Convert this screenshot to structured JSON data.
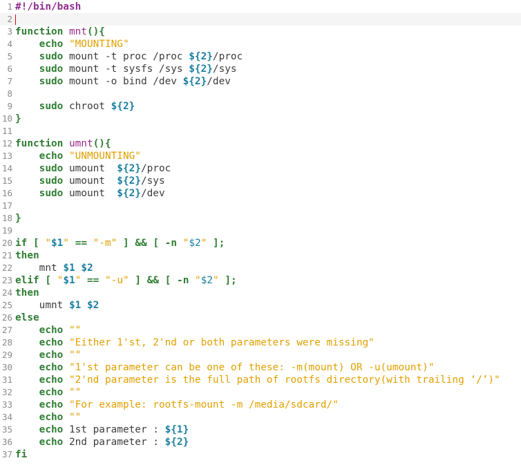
{
  "editor": {
    "current_line": 2,
    "lines": [
      {
        "n": "1",
        "tokens": [
          {
            "t": "shebang",
            "v": "#!/bin/bash"
          }
        ]
      },
      {
        "n": "2",
        "tokens": []
      },
      {
        "n": "3",
        "tokens": [
          {
            "t": "keyword",
            "v": "function"
          },
          {
            "t": "text",
            "v": " "
          },
          {
            "t": "funcname",
            "v": "mnt"
          },
          {
            "t": "op",
            "v": "(){"
          }
        ]
      },
      {
        "n": "4",
        "tokens": [
          {
            "t": "text",
            "v": "    "
          },
          {
            "t": "builtin",
            "v": "echo"
          },
          {
            "t": "text",
            "v": " "
          },
          {
            "t": "string",
            "v": "\"MOUNTING\""
          }
        ]
      },
      {
        "n": "5",
        "tokens": [
          {
            "t": "text",
            "v": "    "
          },
          {
            "t": "builtin",
            "v": "sudo"
          },
          {
            "t": "text",
            "v": " mount -t proc /proc "
          },
          {
            "t": "var-b",
            "v": "${2}"
          },
          {
            "t": "text",
            "v": "/proc"
          }
        ]
      },
      {
        "n": "6",
        "tokens": [
          {
            "t": "text",
            "v": "    "
          },
          {
            "t": "builtin",
            "v": "sudo"
          },
          {
            "t": "text",
            "v": " mount -t sysfs /sys "
          },
          {
            "t": "var-b",
            "v": "${2}"
          },
          {
            "t": "text",
            "v": "/sys"
          }
        ]
      },
      {
        "n": "7",
        "tokens": [
          {
            "t": "text",
            "v": "    "
          },
          {
            "t": "builtin",
            "v": "sudo"
          },
          {
            "t": "text",
            "v": " mount -o bind /dev "
          },
          {
            "t": "var-b",
            "v": "${2}"
          },
          {
            "t": "text",
            "v": "/dev"
          }
        ]
      },
      {
        "n": "8",
        "tokens": []
      },
      {
        "n": "9",
        "tokens": [
          {
            "t": "text",
            "v": "    "
          },
          {
            "t": "builtin",
            "v": "sudo"
          },
          {
            "t": "text",
            "v": " chroot "
          },
          {
            "t": "var-b",
            "v": "${2}"
          }
        ]
      },
      {
        "n": "10",
        "tokens": [
          {
            "t": "op",
            "v": "}"
          }
        ]
      },
      {
        "n": "11",
        "tokens": []
      },
      {
        "n": "12",
        "tokens": [
          {
            "t": "keyword",
            "v": "function"
          },
          {
            "t": "text",
            "v": " "
          },
          {
            "t": "funcname",
            "v": "umnt"
          },
          {
            "t": "op",
            "v": "(){"
          }
        ]
      },
      {
        "n": "13",
        "tokens": [
          {
            "t": "text",
            "v": "    "
          },
          {
            "t": "builtin",
            "v": "echo"
          },
          {
            "t": "text",
            "v": " "
          },
          {
            "t": "string",
            "v": "\"UNMOUNTING\""
          }
        ]
      },
      {
        "n": "14",
        "tokens": [
          {
            "t": "text",
            "v": "    "
          },
          {
            "t": "builtin",
            "v": "sudo"
          },
          {
            "t": "text",
            "v": " umount  "
          },
          {
            "t": "var-b",
            "v": "${2}"
          },
          {
            "t": "text",
            "v": "/proc"
          }
        ]
      },
      {
        "n": "15",
        "tokens": [
          {
            "t": "text",
            "v": "    "
          },
          {
            "t": "builtin",
            "v": "sudo"
          },
          {
            "t": "text",
            "v": " umount  "
          },
          {
            "t": "var-b",
            "v": "${2}"
          },
          {
            "t": "text",
            "v": "/sys"
          }
        ]
      },
      {
        "n": "16",
        "tokens": [
          {
            "t": "text",
            "v": "    "
          },
          {
            "t": "builtin",
            "v": "sudo"
          },
          {
            "t": "text",
            "v": " umount  "
          },
          {
            "t": "var-b",
            "v": "${2}"
          },
          {
            "t": "text",
            "v": "/dev"
          }
        ]
      },
      {
        "n": "17",
        "tokens": []
      },
      {
        "n": "18",
        "tokens": [
          {
            "t": "op",
            "v": "}"
          }
        ]
      },
      {
        "n": "19",
        "tokens": []
      },
      {
        "n": "20",
        "tokens": [
          {
            "t": "keyword",
            "v": "if"
          },
          {
            "t": "text",
            "v": " "
          },
          {
            "t": "op",
            "v": "["
          },
          {
            "t": "text",
            "v": " "
          },
          {
            "t": "string",
            "v": "\""
          },
          {
            "t": "var-b",
            "v": "$1"
          },
          {
            "t": "string",
            "v": "\""
          },
          {
            "t": "text",
            "v": " "
          },
          {
            "t": "op",
            "v": "=="
          },
          {
            "t": "text",
            "v": " "
          },
          {
            "t": "string",
            "v": "\"-m\""
          },
          {
            "t": "text",
            "v": " "
          },
          {
            "t": "op",
            "v": "]"
          },
          {
            "t": "text",
            "v": " "
          },
          {
            "t": "op",
            "v": "&&"
          },
          {
            "t": "text",
            "v": " "
          },
          {
            "t": "op",
            "v": "["
          },
          {
            "t": "text",
            "v": " "
          },
          {
            "t": "op",
            "v": "-n"
          },
          {
            "t": "text",
            "v": " "
          },
          {
            "t": "string",
            "v": "\""
          },
          {
            "t": "var",
            "v": "$2"
          },
          {
            "t": "string",
            "v": "\""
          },
          {
            "t": "text",
            "v": " "
          },
          {
            "t": "op",
            "v": "];"
          }
        ]
      },
      {
        "n": "21",
        "tokens": [
          {
            "t": "keyword",
            "v": "then"
          }
        ]
      },
      {
        "n": "22",
        "tokens": [
          {
            "t": "text",
            "v": "    mnt "
          },
          {
            "t": "var-b",
            "v": "$1"
          },
          {
            "t": "text",
            "v": " "
          },
          {
            "t": "var-b",
            "v": "$2"
          }
        ]
      },
      {
        "n": "23",
        "tokens": [
          {
            "t": "keyword",
            "v": "elif"
          },
          {
            "t": "text",
            "v": " "
          },
          {
            "t": "op",
            "v": "["
          },
          {
            "t": "text",
            "v": " "
          },
          {
            "t": "string",
            "v": "\""
          },
          {
            "t": "var-b",
            "v": "$1"
          },
          {
            "t": "string",
            "v": "\""
          },
          {
            "t": "text",
            "v": " "
          },
          {
            "t": "op",
            "v": "=="
          },
          {
            "t": "text",
            "v": " "
          },
          {
            "t": "string",
            "v": "\"-u\""
          },
          {
            "t": "text",
            "v": " "
          },
          {
            "t": "op",
            "v": "]"
          },
          {
            "t": "text",
            "v": " "
          },
          {
            "t": "op",
            "v": "&&"
          },
          {
            "t": "text",
            "v": " "
          },
          {
            "t": "op",
            "v": "["
          },
          {
            "t": "text",
            "v": " "
          },
          {
            "t": "op",
            "v": "-n"
          },
          {
            "t": "text",
            "v": " "
          },
          {
            "t": "string",
            "v": "\""
          },
          {
            "t": "var",
            "v": "$2"
          },
          {
            "t": "string",
            "v": "\""
          },
          {
            "t": "text",
            "v": " "
          },
          {
            "t": "op",
            "v": "];"
          }
        ]
      },
      {
        "n": "24",
        "tokens": [
          {
            "t": "keyword",
            "v": "then"
          }
        ]
      },
      {
        "n": "25",
        "tokens": [
          {
            "t": "text",
            "v": "    umnt "
          },
          {
            "t": "var-b",
            "v": "$1"
          },
          {
            "t": "text",
            "v": " "
          },
          {
            "t": "var-b",
            "v": "$2"
          }
        ]
      },
      {
        "n": "26",
        "tokens": [
          {
            "t": "keyword",
            "v": "else"
          }
        ]
      },
      {
        "n": "27",
        "tokens": [
          {
            "t": "text",
            "v": "    "
          },
          {
            "t": "builtin",
            "v": "echo"
          },
          {
            "t": "text",
            "v": " "
          },
          {
            "t": "string",
            "v": "\"\""
          }
        ]
      },
      {
        "n": "28",
        "tokens": [
          {
            "t": "text",
            "v": "    "
          },
          {
            "t": "builtin",
            "v": "echo"
          },
          {
            "t": "text",
            "v": " "
          },
          {
            "t": "string",
            "v": "\"Either 1'st, 2'nd or both parameters were missing\""
          }
        ]
      },
      {
        "n": "29",
        "tokens": [
          {
            "t": "text",
            "v": "    "
          },
          {
            "t": "builtin",
            "v": "echo"
          },
          {
            "t": "text",
            "v": " "
          },
          {
            "t": "string",
            "v": "\"\""
          }
        ]
      },
      {
        "n": "30",
        "tokens": [
          {
            "t": "text",
            "v": "    "
          },
          {
            "t": "builtin",
            "v": "echo"
          },
          {
            "t": "text",
            "v": " "
          },
          {
            "t": "string",
            "v": "\"1'st parameter can be one of these: -m(mount) OR -u(umount)\""
          }
        ]
      },
      {
        "n": "31",
        "tokens": [
          {
            "t": "text",
            "v": "    "
          },
          {
            "t": "builtin",
            "v": "echo"
          },
          {
            "t": "text",
            "v": " "
          },
          {
            "t": "string",
            "v": "\"2'nd parameter is the full path of rootfs directory(with trailing ‘/’)\""
          }
        ]
      },
      {
        "n": "32",
        "tokens": [
          {
            "t": "text",
            "v": "    "
          },
          {
            "t": "builtin",
            "v": "echo"
          },
          {
            "t": "text",
            "v": " "
          },
          {
            "t": "string",
            "v": "\"\""
          }
        ]
      },
      {
        "n": "33",
        "tokens": [
          {
            "t": "text",
            "v": "    "
          },
          {
            "t": "builtin",
            "v": "echo"
          },
          {
            "t": "text",
            "v": " "
          },
          {
            "t": "string",
            "v": "\"For example: rootfs-mount -m /media/sdcard/\""
          }
        ]
      },
      {
        "n": "34",
        "tokens": [
          {
            "t": "text",
            "v": "    "
          },
          {
            "t": "builtin",
            "v": "echo"
          },
          {
            "t": "text",
            "v": " "
          },
          {
            "t": "string",
            "v": "\"\""
          }
        ]
      },
      {
        "n": "35",
        "tokens": [
          {
            "t": "text",
            "v": "    "
          },
          {
            "t": "builtin",
            "v": "echo"
          },
          {
            "t": "text",
            "v": " 1st parameter : "
          },
          {
            "t": "var-b",
            "v": "${1}"
          }
        ]
      },
      {
        "n": "36",
        "tokens": [
          {
            "t": "text",
            "v": "    "
          },
          {
            "t": "builtin",
            "v": "echo"
          },
          {
            "t": "text",
            "v": " 2nd parameter : "
          },
          {
            "t": "var-b",
            "v": "${2}"
          }
        ]
      },
      {
        "n": "37",
        "tokens": [
          {
            "t": "keyword",
            "v": "fi"
          }
        ]
      }
    ]
  },
  "colors": {
    "keyword": "#2e7d32",
    "function_name": "#9c2a8c",
    "string": "#e0a000",
    "variable": "#1a7fa0",
    "line_number": "#8a8a8a",
    "cursor": "#e00000",
    "current_line_bg": "#f5f5f5"
  }
}
